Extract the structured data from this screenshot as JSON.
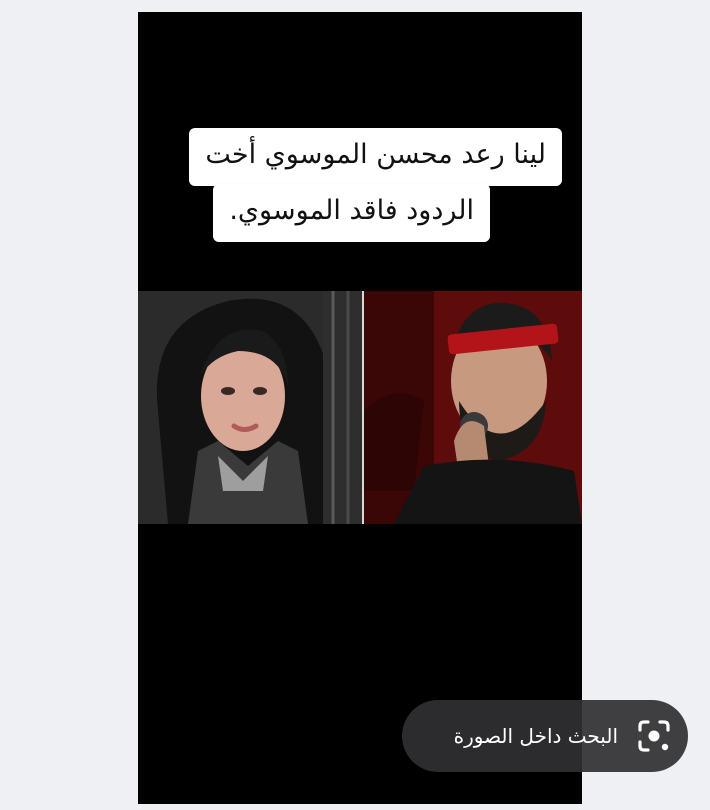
{
  "thumbnail": {
    "caption_line1": "لينا رعد محسن الموسوي أخت",
    "caption_line2": "الردود فاقد الموسوي."
  },
  "lens_button": {
    "label": "البحث داخل الصورة",
    "icon": "lens-icon"
  },
  "colors": {
    "page_background": "#eef0f3",
    "thumbnail_background": "#000000",
    "pill_background": "#303032",
    "caption_background": "#ffffff"
  }
}
